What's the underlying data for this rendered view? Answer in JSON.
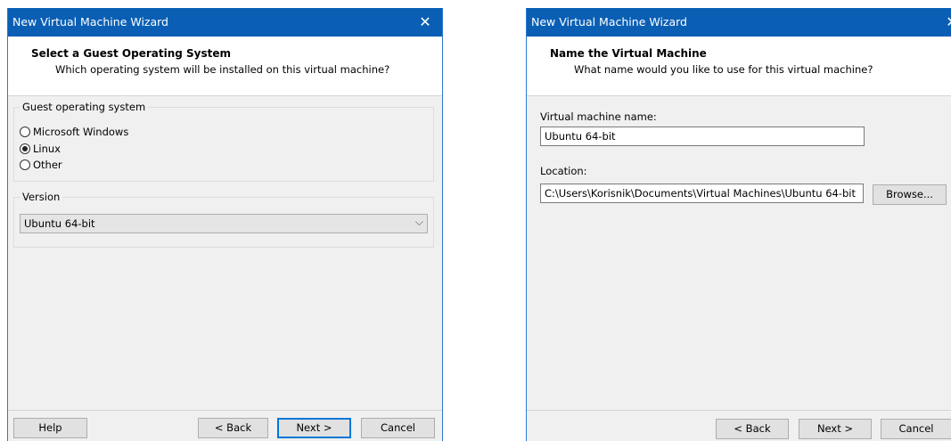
{
  "window1": {
    "title": "New Virtual Machine Wizard",
    "close_glyph": "✕",
    "header": {
      "title": "Select a Guest Operating System",
      "subtitle": "Which operating system will be installed on this virtual machine?"
    },
    "guest_os": {
      "legend": "Guest operating system",
      "options": [
        "Microsoft Windows",
        "Linux",
        "Other"
      ],
      "selected": "Linux"
    },
    "version": {
      "legend": "Version",
      "selected": "Ubuntu 64-bit",
      "chevron": "⌵"
    },
    "buttons": {
      "help": "Help",
      "back": "< Back",
      "next": "Next >",
      "cancel": "Cancel"
    }
  },
  "window2": {
    "title": "New Virtual Machine Wizard",
    "close_glyph": "✕",
    "header": {
      "title": "Name the Virtual Machine",
      "subtitle": "What name would you like to use for this virtual machine?"
    },
    "vm_name": {
      "label": "Virtual machine name:",
      "value": "Ubuntu 64-bit"
    },
    "location": {
      "label": "Location:",
      "value": "C:\\Users\\Korisnik\\Documents\\Virtual Machines\\Ubuntu 64-bit",
      "browse_label": "Browse..."
    },
    "buttons": {
      "back": "< Back",
      "next": "Next >",
      "cancel": "Cancel"
    }
  },
  "colors": {
    "titlebar": "#0a5fb4",
    "dialog_bg": "#f0f0f0",
    "default_button_border": "#0078d7"
  },
  "icons": [
    "close-icon",
    "chevron-down-icon",
    "radio-icon"
  ]
}
